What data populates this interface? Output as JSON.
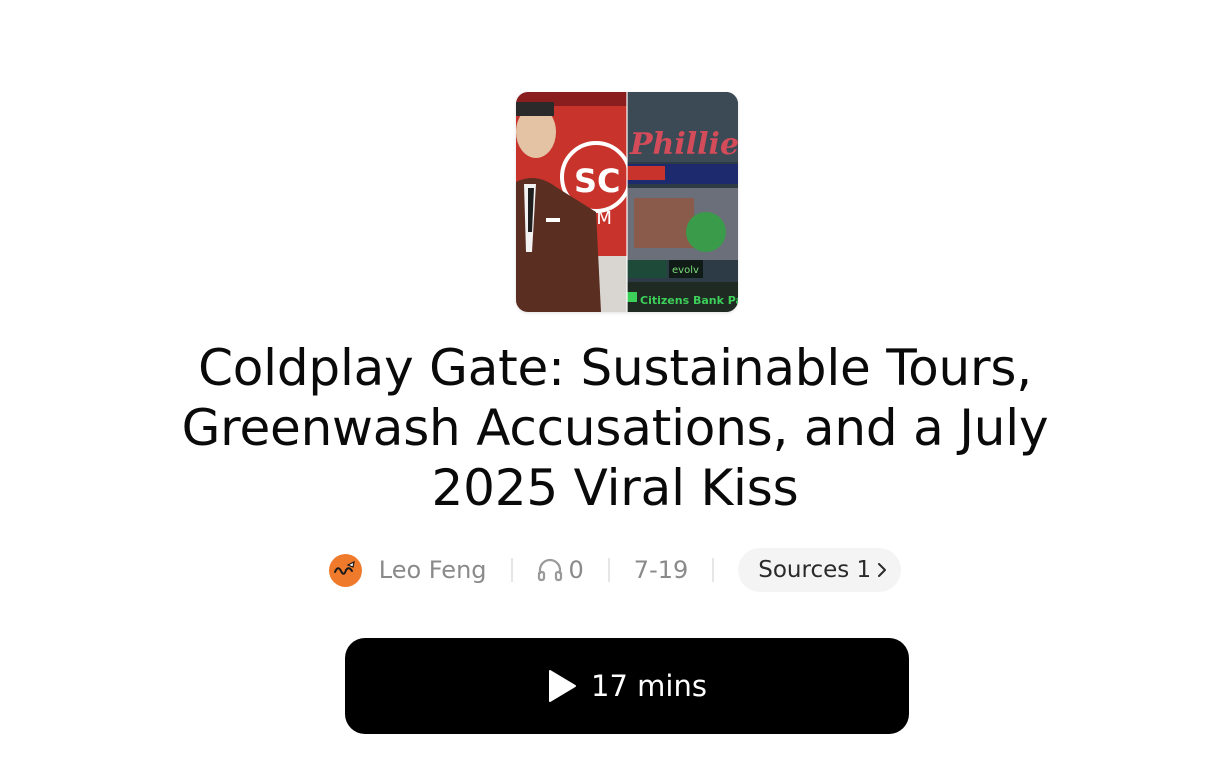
{
  "episode": {
    "title": "Coldplay Gate: Sustainable Tours, Greenwash Accusations, and a July 2025 Viral Kiss",
    "cover_icon": "episode-cover-image"
  },
  "meta": {
    "author": "Leo Feng",
    "avatar_icon": "author-avatar-icon",
    "listen_icon": "headphones-icon",
    "listens": "0",
    "date": "7-19",
    "sources_label": "Sources 1",
    "sources_icon": "chevron-right-icon"
  },
  "player": {
    "play_icon": "play-icon",
    "duration_label": "17 mins"
  },
  "colors": {
    "accent_orange": "#f07a2b",
    "button_bg": "#000000",
    "muted_text": "#8a8a8a"
  }
}
